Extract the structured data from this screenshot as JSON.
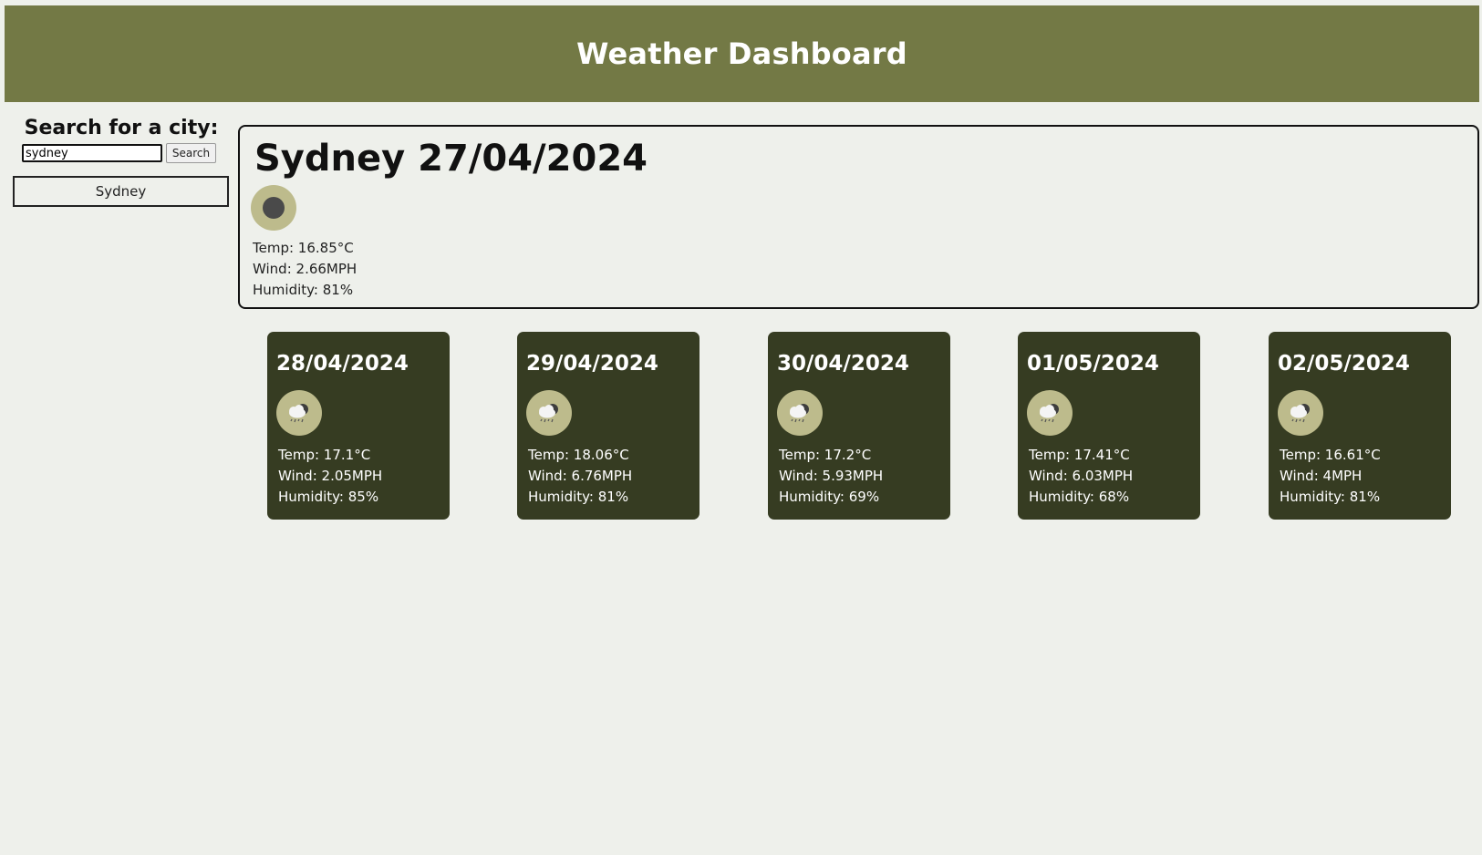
{
  "header": {
    "title": "Weather Dashboard"
  },
  "sidebar": {
    "search_title": "Search for a city:",
    "search_value": "sydney",
    "search_button": "Search",
    "history": [
      "Sydney"
    ]
  },
  "current": {
    "title": "Sydney 27/04/2024",
    "icon": "moon-clear-icon",
    "temp": "Temp: 16.85°C",
    "wind": "Wind: 2.66MPH",
    "humidity": "Humidity: 81%"
  },
  "forecast": [
    {
      "date": "28/04/2024",
      "icon": "rain-cloud-night-icon",
      "temp": "Temp: 17.1°C",
      "wind": "Wind: 2.05MPH",
      "humidity": "Humidity: 85%"
    },
    {
      "date": "29/04/2024",
      "icon": "rain-cloud-night-icon",
      "temp": "Temp: 18.06°C",
      "wind": "Wind: 6.76MPH",
      "humidity": "Humidity: 81%"
    },
    {
      "date": "30/04/2024",
      "icon": "rain-cloud-night-icon",
      "temp": "Temp: 17.2°C",
      "wind": "Wind: 5.93MPH",
      "humidity": "Humidity: 69%"
    },
    {
      "date": "01/05/2024",
      "icon": "rain-cloud-night-icon",
      "temp": "Temp: 17.41°C",
      "wind": "Wind: 6.03MPH",
      "humidity": "Humidity: 68%"
    },
    {
      "date": "02/05/2024",
      "icon": "rain-cloud-night-icon",
      "temp": "Temp: 16.61°C",
      "wind": "Wind: 4MPH",
      "humidity": "Humidity: 81%"
    }
  ],
  "colors": {
    "header_bg": "#737945",
    "page_bg": "#eef0eb",
    "card_bg": "#363c22",
    "icon_badge": "#bdbb8c"
  }
}
